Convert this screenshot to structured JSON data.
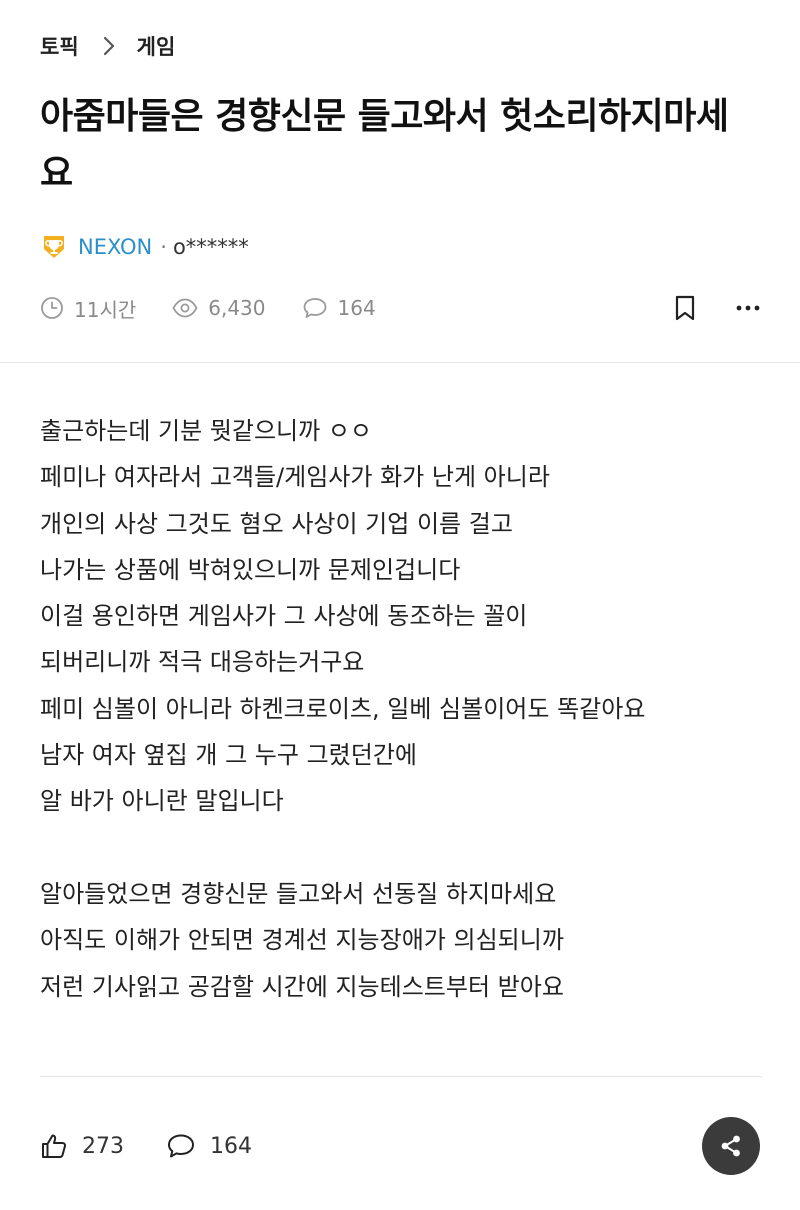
{
  "breadcrumb": {
    "topic": "토픽",
    "category": "게임"
  },
  "post": {
    "title": "아줌마들은 경향신문 들고와서 헛소리하지마세요",
    "company": "NEXON",
    "author": "o******",
    "time": "11시간",
    "views": "6,430",
    "comments": "164",
    "body_lines": [
      "출근하는데 기분 뭣같으니까 ㅇㅇ",
      "페미나 여자라서 고객들/게임사가 화가 난게 아니라",
      "개인의 사상 그것도 혐오 사상이 기업 이름 걸고",
      "나가는 상품에 박혀있으니까 문제인겁니다",
      "이걸 용인하면 게임사가 그 사상에 동조하는 꼴이",
      "되버리니까 적극 대응하는거구요",
      "페미 심볼이 아니라 하켄크로이츠, 일베 심볼이어도 똑같아요",
      "남자 여자 옆집 개 그 누구 그렸던간에",
      "알 바가 아니란 말입니다",
      "",
      "알아들었으면 경향신문 들고와서 선동질 하지마세요",
      "아직도 이해가 안되면 경계선 지능장애가 의심되니까",
      "저런 기사읽고 공감할 시간에 지능테스트부터 받아요"
    ]
  },
  "footer": {
    "likes": "273",
    "comments": "164"
  },
  "colors": {
    "company_link": "#2b8fc9",
    "share_button": "#3b3b3b",
    "trophy": "#f2b01e"
  },
  "icons": {
    "breadcrumb_separator": "chevron-right-icon",
    "badge": "trophy-icon",
    "time": "clock-icon",
    "views": "eye-icon",
    "comments": "speech-bubble-icon",
    "bookmark": "bookmark-icon",
    "more": "more-dots-icon",
    "like": "thumbs-up-icon",
    "share": "share-icon"
  }
}
